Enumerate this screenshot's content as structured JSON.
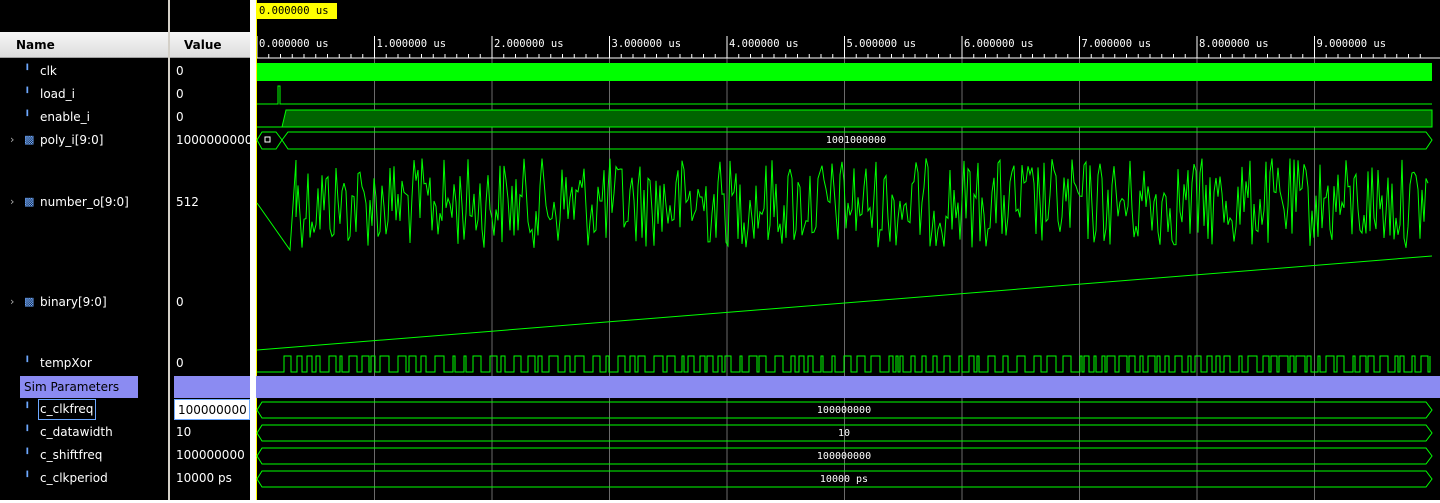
{
  "headers": {
    "name": "Name",
    "value": "Value"
  },
  "cursor_time": "0.000000 us",
  "time_axis": {
    "unit": "us",
    "labels": [
      "0.000000 us",
      "1.000000 us",
      "2.000000 us",
      "3.000000 us",
      "4.000000 us",
      "5.000000 us",
      "6.000000 us",
      "7.000000 us",
      "8.000000 us",
      "9.000000 us"
    ]
  },
  "signals": [
    {
      "name": "clk",
      "value": "0",
      "expandable": false,
      "icon": "bit-signal-icon"
    },
    {
      "name": "load_i",
      "value": "0",
      "expandable": false,
      "icon": "bit-signal-icon"
    },
    {
      "name": "enable_i",
      "value": "0",
      "expandable": false,
      "icon": "bit-signal-icon"
    },
    {
      "name": "poly_i[9:0]",
      "value": "1000000000",
      "expandable": true,
      "icon": "bus-signal-icon",
      "bus_initial": "0",
      "bus_value": "1001000000"
    },
    {
      "name": "number_o[9:0]",
      "value": "512",
      "expandable": true,
      "icon": "bus-signal-icon"
    },
    {
      "name": "binary[9:0]",
      "value": "0",
      "expandable": true,
      "icon": "bus-signal-icon"
    },
    {
      "name": "tempXor",
      "value": "0",
      "expandable": false,
      "icon": "bit-signal-icon"
    }
  ],
  "group": {
    "name": "Sim Parameters"
  },
  "params": [
    {
      "name": "c_clkfreq",
      "value": "100000000",
      "wave_text": "100000000"
    },
    {
      "name": "c_datawidth",
      "value": "10",
      "wave_text": "10"
    },
    {
      "name": "c_shiftfreq",
      "value": "100000000",
      "wave_text": "100000000"
    },
    {
      "name": "c_clkperiod",
      "value": "10000 ps",
      "wave_text": "10000 ps"
    }
  ],
  "colors": {
    "wave": "#00ff00",
    "group": "#8b8bf2",
    "cursor": "#ffff00",
    "grid": "#808080"
  }
}
